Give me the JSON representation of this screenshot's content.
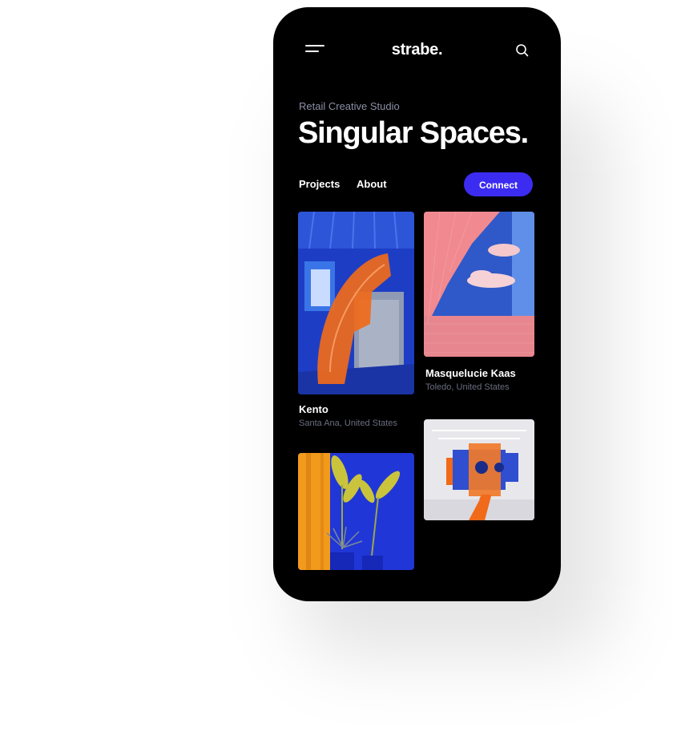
{
  "app": {
    "logo": "strabe.",
    "menu_icon": "hamburger-menu-icon",
    "search_icon": "search-icon"
  },
  "hero": {
    "eyebrow": "Retail Creative Studio",
    "title": "Singular Spaces."
  },
  "nav": {
    "projects": "Projects",
    "about": "About",
    "connect": "Connect"
  },
  "colors": {
    "background": "#000000",
    "accent": "#3c2cf2",
    "muted_text": "#6a6e80"
  },
  "projects": [
    {
      "name": "Kento",
      "location": "Santa Ana, United States"
    },
    {
      "name": "Masquelucie Kaas",
      "location": "Toledo, United States"
    },
    {
      "name": "",
      "location": ""
    },
    {
      "name": "",
      "location": ""
    }
  ]
}
